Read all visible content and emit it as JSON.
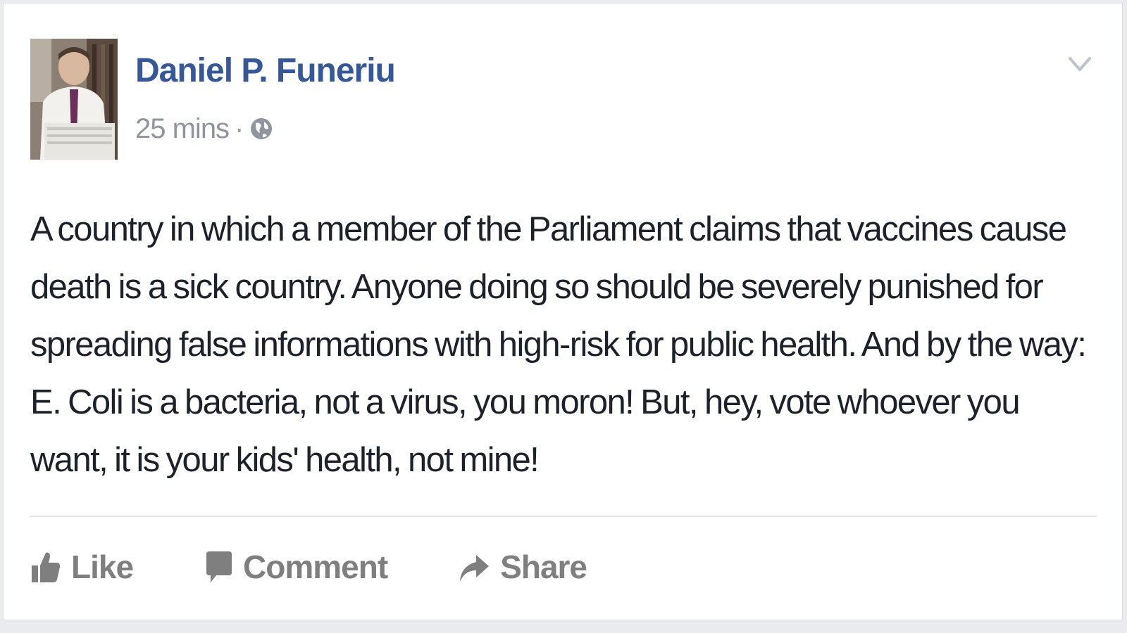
{
  "post": {
    "author_name": "Daniel P. Funeriu",
    "timestamp": "25 mins",
    "separator": "·",
    "privacy_icon": "globe-icon",
    "menu_icon": "chevron-down-icon",
    "body": "A country in which a member of the Parliament claims that vaccines cause\ndeath is a sick country. Anyone doing so should be severely punished for\nspreading false informations with high-risk for public health. And by the way:\nE. Coli is a bacteria, not a virus, you moron! But, hey, vote whoever you\nwant, it is your kids' health, not mine!"
  },
  "actions": {
    "like_label": "Like",
    "comment_label": "Comment",
    "share_label": "Share"
  },
  "colors": {
    "author_link": "#365899",
    "meta_text": "#90949c",
    "body_text": "#1d2129",
    "action_text": "#7f7f7f"
  }
}
